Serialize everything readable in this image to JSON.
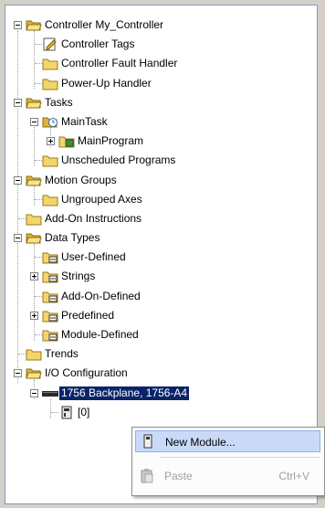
{
  "tree": {
    "items": [
      {
        "label": "Controller My_Controller"
      },
      {
        "label": "Controller Tags"
      },
      {
        "label": "Controller Fault Handler"
      },
      {
        "label": "Power-Up Handler"
      },
      {
        "label": "Tasks"
      },
      {
        "label": "MainTask"
      },
      {
        "label": "MainProgram"
      },
      {
        "label": "Unscheduled Programs"
      },
      {
        "label": "Motion Groups"
      },
      {
        "label": "Ungrouped Axes"
      },
      {
        "label": "Add-On Instructions"
      },
      {
        "label": "Data Types"
      },
      {
        "label": "User-Defined"
      },
      {
        "label": "Strings"
      },
      {
        "label": "Add-On-Defined"
      },
      {
        "label": "Predefined"
      },
      {
        "label": "Module-Defined"
      },
      {
        "label": "Trends"
      },
      {
        "label": "I/O Configuration"
      },
      {
        "label": "1756 Backplane, 1756-A4"
      },
      {
        "label": "[0]"
      }
    ]
  },
  "context_menu": {
    "new_module": {
      "label": "New Module..."
    },
    "paste": {
      "label": "Paste",
      "shortcut": "Ctrl+V"
    }
  },
  "colors": {
    "selection": "#0a246a",
    "menu_hover": "#c9daf8",
    "folder": "#f2d669"
  }
}
